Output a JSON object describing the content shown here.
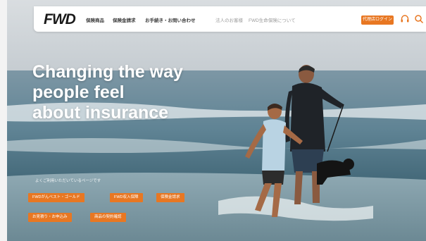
{
  "nav": {
    "logo": "FWD",
    "links": [
      "保険商品",
      "保険金請求",
      "お手続き・お問い合わせ"
    ],
    "secondary_links": [
      "法人のお客様",
      "FWD生命保険について"
    ],
    "cta": "代理店ログイン",
    "icons": [
      "headset-icon",
      "search-icon"
    ]
  },
  "hero": {
    "headline": [
      "Changing the way",
      "people feel",
      "about insurance"
    ],
    "lead": "よくご利用いただいているページです",
    "quick_links": [
      "FWDがんベスト・ゴールド",
      "FWD収入保障",
      "保険金請求",
      "お見積り・お申込み",
      "商品の契約確認"
    ]
  },
  "colors": {
    "accent": "#e87722",
    "nav_bg": "#ffffff"
  }
}
